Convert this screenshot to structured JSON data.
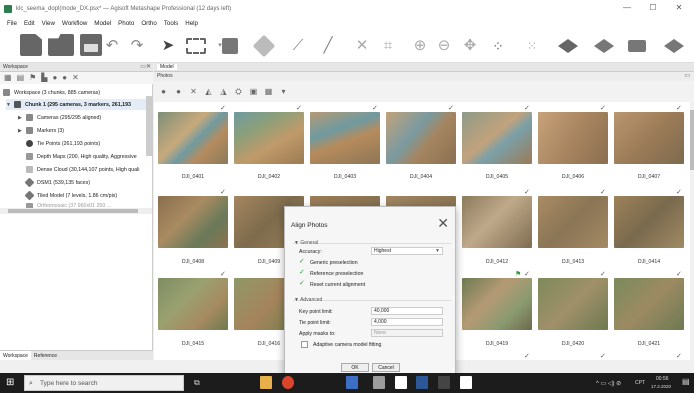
{
  "window": {
    "title": "klc_seema_dopl(mode_DX.psx* — Agisoft Metashape Professional (12 days left)"
  },
  "menu": [
    "File",
    "Edit",
    "View",
    "Workflow",
    "Model",
    "Photo",
    "Ortho",
    "Tools",
    "Help"
  ],
  "workspace": {
    "header": "Workspace",
    "root": "Workspace (3 chunks, 885 cameras)",
    "chunk": "Chunk 1 (295 cameras, 3 markers, 261,193",
    "items": [
      "Cameras (295/295 aligned)",
      "Markers (3)",
      "Tie Points (261,193 points)",
      "Depth Maps (200, High quality, Aggressive",
      "Dense Cloud (30,144,107 points, High quali",
      "DSM1 (539,135 faces)",
      "Tiled Model (7 levels, 1.86 cm/pix)",
      "Orthomosaic (37 960x01 250 ..."
    ],
    "tabs": [
      "Workspace",
      "Reference"
    ]
  },
  "model_tab": "Model",
  "photos": {
    "header": "Photos",
    "rows": [
      [
        "DJI_0401",
        "DJI_0402",
        "DJI_0403",
        "DJI_0404",
        "DJI_0405",
        "DJI_0406",
        "DJI_0407"
      ],
      [
        "DJI_0408",
        "DJI_0409",
        "",
        "",
        "DJI_0412",
        "DJI_0413",
        "DJI_0414"
      ],
      [
        "DJI_0415",
        "DJI_0416",
        "",
        "",
        "DJI_0419",
        "DJI_0420",
        "DJI_0421"
      ]
    ]
  },
  "dialog": {
    "title": "Align Photos",
    "general": "General",
    "accuracy_label": "Accuracy:",
    "accuracy_value": "Highest",
    "generic_preselection": "Generic preselection",
    "reference_preselection": "Reference preselection",
    "reset_alignment": "Reset current alignment",
    "advanced": "Advanced",
    "key_point_label": "Key point limit:",
    "key_point_value": "40,000",
    "tie_point_label": "Tie point limit:",
    "tie_point_value": "4,000",
    "apply_masks_label": "Apply masks to:",
    "apply_masks_value": "None",
    "adaptive_fitting": "Adaptive camera model fitting",
    "ok": "OK",
    "cancel": "Cancel"
  },
  "taskbar": {
    "search_placeholder": "Type here to search",
    "lang": "CPT",
    "time": "00:56",
    "date": "17.2.2020"
  },
  "colors": {
    "accent": "#2e7d4f",
    "check": "#2e9e3e",
    "taskbar": "#1c1c1c"
  }
}
